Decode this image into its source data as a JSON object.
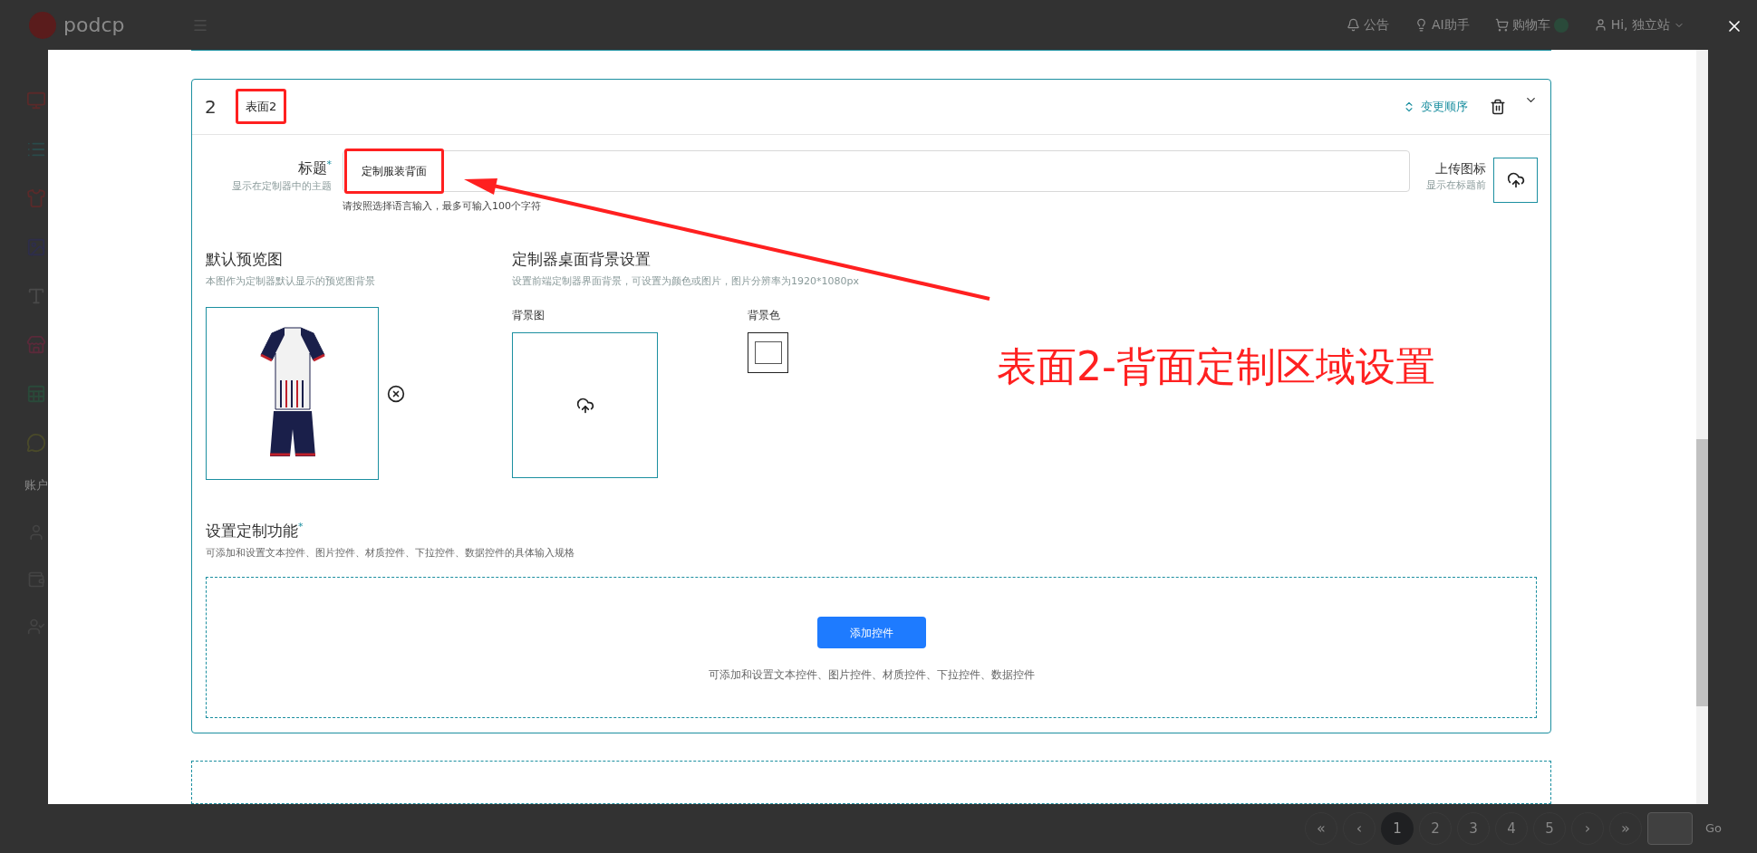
{
  "header": {
    "logo": "podcp",
    "nav": [
      {
        "kind": "bell",
        "label": "公告"
      },
      {
        "kind": "bulb",
        "label": "AI助手"
      },
      {
        "kind": "cart",
        "label": "购物车"
      },
      {
        "kind": "user",
        "label": "Hi, 独立站"
      }
    ]
  },
  "sidebar": {
    "items": [
      {
        "kind": "monitor",
        "color": "#5a2a2a"
      },
      {
        "kind": "list",
        "color": "#2a4a4a"
      },
      {
        "kind": "shirt",
        "color": "#5a2a2a"
      },
      {
        "kind": "image",
        "color": "#2e2e4a"
      },
      {
        "kind": "font",
        "color": "#4a4a4a"
      },
      {
        "kind": "store",
        "color": "#5a2a3a"
      },
      {
        "kind": "sheet",
        "color": "#2a4a3a"
      },
      {
        "kind": "chat",
        "color": "#4a4a2a"
      }
    ],
    "section": "账户",
    "account_items": [
      {
        "kind": "person"
      },
      {
        "kind": "wallet"
      },
      {
        "kind": "badge"
      }
    ]
  },
  "pagination": {
    "first": "«",
    "prev": "‹",
    "pages": [
      {
        "label": "1",
        "selected": true
      },
      {
        "label": "2",
        "selected": false
      },
      {
        "label": "3",
        "selected": false
      },
      {
        "label": "4",
        "selected": false
      },
      {
        "label": "5",
        "selected": false
      }
    ],
    "next": "›",
    "last": "»",
    "go": "Go"
  },
  "modal": {
    "surface": {
      "number": "2",
      "name": "表面2",
      "name_highlighted": true,
      "reorder": "变更顺序",
      "title_field": {
        "label": "标题",
        "required_mark": "*",
        "sublabel": "显示在定制器中的主题",
        "value": "定制服装背面",
        "value_highlighted": true,
        "hint": "请按照选择语言输入，最多可输入100个字符"
      },
      "icon_upload": {
        "label": "上传图标",
        "sublabel": "显示在标题前"
      },
      "preview": {
        "title": "默认预览图",
        "subtitle": "本图作为定制器默认显示的预览图背景"
      },
      "background": {
        "title": "定制器桌面背景设置",
        "subtitle": "设置前端定制器界面背景，可设置为颜色或图片，图片分辨率为1920*1080px",
        "image_label": "背景图",
        "color_label": "背景色"
      },
      "functions": {
        "title": "设置定制功能",
        "required_mark": "*",
        "subtitle": "可添加和设置文本控件、图片控件、材质控件、下拉控件、数据控件的具体输入规格",
        "button": "添加控件",
        "hint": "可添加和设置文本控件、图片控件、材质控件、下拉控件、数据控件"
      }
    }
  },
  "annotation": {
    "callout": "表面2-背面定制区域设置"
  }
}
